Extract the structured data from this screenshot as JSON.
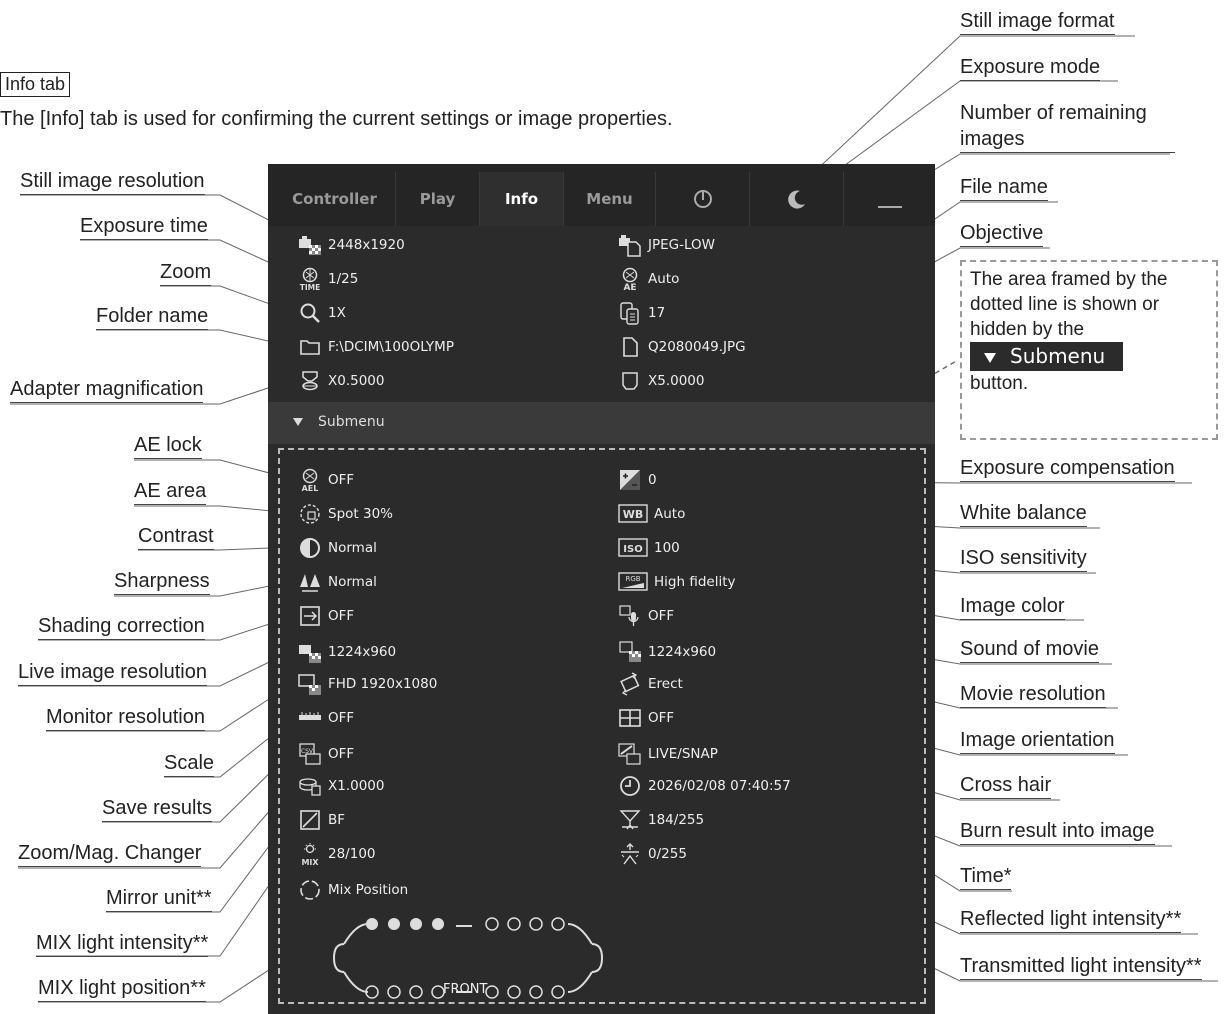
{
  "intro": {
    "tab_label": "Info tab",
    "description": "The [Info] tab is used for confirming the current settings or image properties."
  },
  "tabs": [
    {
      "label": "Controller",
      "active": false
    },
    {
      "label": "Play",
      "active": false
    },
    {
      "label": "Info",
      "active": true
    },
    {
      "label": "Menu",
      "active": false
    },
    {
      "label": "",
      "icon": "power-icon"
    },
    {
      "label": "",
      "icon": "moon-icon"
    },
    {
      "label": "",
      "icon": "minimize-icon"
    }
  ],
  "main_left": [
    {
      "icon": "still-resolution-icon",
      "value": "2448x1920"
    },
    {
      "icon": "exposure-time-icon",
      "value": "1/25"
    },
    {
      "icon": "zoom-icon",
      "value": "1X"
    },
    {
      "icon": "folder-icon",
      "value": "F:\\DCIM\\100OLYMP"
    },
    {
      "icon": "adapter-icon",
      "value": "X0.5000"
    }
  ],
  "main_right": [
    {
      "icon": "image-format-icon",
      "value": "JPEG-LOW"
    },
    {
      "icon": "exposure-mode-icon",
      "value": "Auto"
    },
    {
      "icon": "remaining-images-icon",
      "value": "17"
    },
    {
      "icon": "file-icon",
      "value": "Q2080049.JPG"
    },
    {
      "icon": "objective-icon",
      "value": "X5.0000"
    }
  ],
  "submenu_label": "Submenu",
  "sub_left": [
    {
      "icon": "ae-lock-icon",
      "value": "OFF"
    },
    {
      "icon": "ae-area-icon",
      "value": "Spot 30%"
    },
    {
      "icon": "contrast-icon",
      "value": "Normal"
    },
    {
      "icon": "sharpness-icon",
      "value": "Normal"
    },
    {
      "icon": "shading-icon",
      "value": "OFF"
    },
    {
      "icon": "live-resolution-icon",
      "value": "1224x960"
    },
    {
      "icon": "monitor-resolution-icon",
      "value": "FHD 1920x1080"
    },
    {
      "icon": "scale-icon",
      "value": "OFF"
    },
    {
      "icon": "save-results-icon",
      "value": "OFF"
    },
    {
      "icon": "zoom-changer-icon",
      "value": "X1.0000"
    },
    {
      "icon": "mirror-unit-icon",
      "value": "BF"
    },
    {
      "icon": "mix-light-icon",
      "value": "28/100"
    },
    {
      "icon": "mix-position-icon",
      "value": "Mix Position"
    }
  ],
  "sub_right": [
    {
      "icon": "exposure-comp-icon",
      "value": "0"
    },
    {
      "icon": "white-balance-icon",
      "value": "Auto"
    },
    {
      "icon": "iso-icon",
      "value": "100"
    },
    {
      "icon": "image-color-icon",
      "value": "High fidelity"
    },
    {
      "icon": "sound-icon",
      "value": "OFF"
    },
    {
      "icon": "movie-resolution-icon",
      "value": "1224x960"
    },
    {
      "icon": "orientation-icon",
      "value": "Erect"
    },
    {
      "icon": "cross-hair-icon",
      "value": "OFF"
    },
    {
      "icon": "burn-result-icon",
      "value": "LIVE/SNAP"
    },
    {
      "icon": "time-icon",
      "value": "2026/02/08  07:40:57"
    },
    {
      "icon": "reflected-light-icon",
      "value": "184/255"
    },
    {
      "icon": "transmitted-light-icon",
      "value": "0/255"
    }
  ],
  "icon_texts": {
    "time": "TIME",
    "ae": "AE",
    "ael": "AEL",
    "wb": "WB",
    "iso": "ISO",
    "rgb": "RGB",
    "csv": "CSV",
    "mix": "MIX"
  },
  "mix_front_label": "FRONT",
  "labels_left": [
    "Still image resolution",
    "Exposure time",
    "Zoom",
    "Folder name",
    "Adapter magnification",
    "AE lock",
    "AE area",
    "Contrast",
    "Sharpness",
    "Shading correction",
    "Live image resolution",
    "Monitor resolution",
    "Scale",
    "Save results",
    "Zoom/Mag. Changer",
    "Mirror unit**",
    "MIX light intensity**",
    "MIX light position**"
  ],
  "labels_right": [
    "Still image format",
    "Exposure mode",
    "Number of remaining images",
    "File name",
    "Objective",
    "Exposure compensation",
    "White balance",
    "ISO sensitivity",
    "Image color",
    "Sound of movie",
    "Movie resolution",
    "Image orientation",
    "Cross hair",
    "Burn result into image",
    "Time*",
    "Reflected light intensity**",
    "Transmitted light intensity**"
  ],
  "note": {
    "text_1": "The area framed by the dotted line is shown or hidden by the",
    "button": "Submenu",
    "text_2": "button."
  }
}
